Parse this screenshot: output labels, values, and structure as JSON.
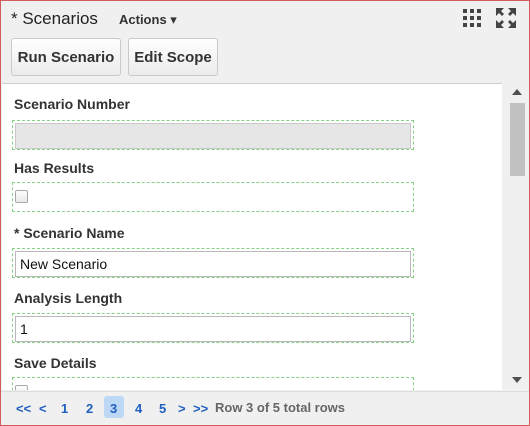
{
  "header": {
    "title": "* Scenarios",
    "actions_label": "Actions ▾"
  },
  "icons": {
    "grid": "grid-icon",
    "expand": "expand-icon"
  },
  "toolbar": {
    "run_label": "Run Scenario",
    "scope_label": "Edit Scope"
  },
  "form": {
    "scenario_number": {
      "label": "Scenario Number",
      "value": ""
    },
    "has_results": {
      "label": "Has Results",
      "checked": false
    },
    "scenario_name": {
      "label": "* Scenario Name",
      "value": "New Scenario"
    },
    "analysis_length": {
      "label": "Analysis Length",
      "value": "1"
    },
    "save_details": {
      "label": "Save Details",
      "checked": false
    }
  },
  "pager": {
    "first": "<<",
    "prev": "<",
    "pages": [
      "1",
      "2",
      "3",
      "4",
      "5"
    ],
    "current": 3,
    "next": ">",
    "last": ">>",
    "row_info": "Row 3 of 5 total rows"
  },
  "colors": {
    "panel_border": "#d35b5b",
    "field_outline": "#86d186",
    "pager_link": "#1f5fbf",
    "page_highlight": "#bcd8f4"
  }
}
